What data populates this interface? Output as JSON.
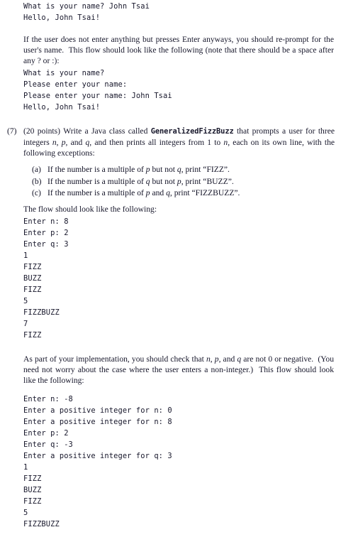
{
  "document": {
    "top_sample_output": [
      "What is your name? John Tsai",
      "Hello, John Tsai!"
    ],
    "intro_paragraph_html": "If the user does not enter anything but presses Enter anyways, you should re-prompt for the user's name.&nbsp; This flow should look like the following (note that there should be a space after any ? or :):",
    "intro_sample_output": [
      "What is your name?",
      "Please enter your name:",
      "Please enter your name: John Tsai",
      "Hello, John Tsai!"
    ],
    "problem": {
      "marker": "(7)",
      "points": "(20 points)",
      "statement_before_class": "Write a Java class called ",
      "class_name": "GeneralizedFizzBuzz",
      "statement_after_class": " that prompts a user for three integers <i>n</i>, <i>p</i>, and <i>q</i>, and then prints all integers from 1 to <i>n</i>, each on its own line, with the following exceptions:",
      "sub_items": [
        {
          "marker": "(a)",
          "text_html": "If the number is a multiple of <i>p</i> but not <i>q</i>, print “FIZZ”."
        },
        {
          "marker": "(b)",
          "text_html": "If the number is a multiple of <i>q</i> but not <i>p</i>, print “BUZZ”."
        },
        {
          "marker": "(c)",
          "text_html": "If the number is a multiple of <i>p</i> and <i>q</i>, print “FIZZBUZZ”."
        }
      ],
      "flow_lead": "The flow should look like the following:",
      "flow_sample_output": [
        "Enter n: 8",
        "Enter p: 2",
        "Enter q: 3",
        "1",
        "FIZZ",
        "BUZZ",
        "FIZZ",
        "5",
        "FIZZBUZZ",
        "7",
        "FIZZ"
      ]
    },
    "validation_paragraph_html": "As part of your implementation, you should check that <i>n</i>, <i>p</i>, and <i>q</i> are not 0 or negative.&nbsp; (You need not worry about the case where the user enters a non-integer.)&nbsp; This flow should look like the following:",
    "validation_sample_output": [
      "Enter n: -8",
      "Enter a positive integer for n: 0",
      "Enter a positive integer for n: 8",
      "Enter p: 2",
      "Enter q: -3",
      "Enter a positive integer for q: 3",
      "1",
      "FIZZ",
      "BUZZ",
      "FIZZ",
      "5",
      "FIZZBUZZ"
    ]
  },
  "colors": {
    "page_background": "#ffffff",
    "text": "#17172b"
  }
}
